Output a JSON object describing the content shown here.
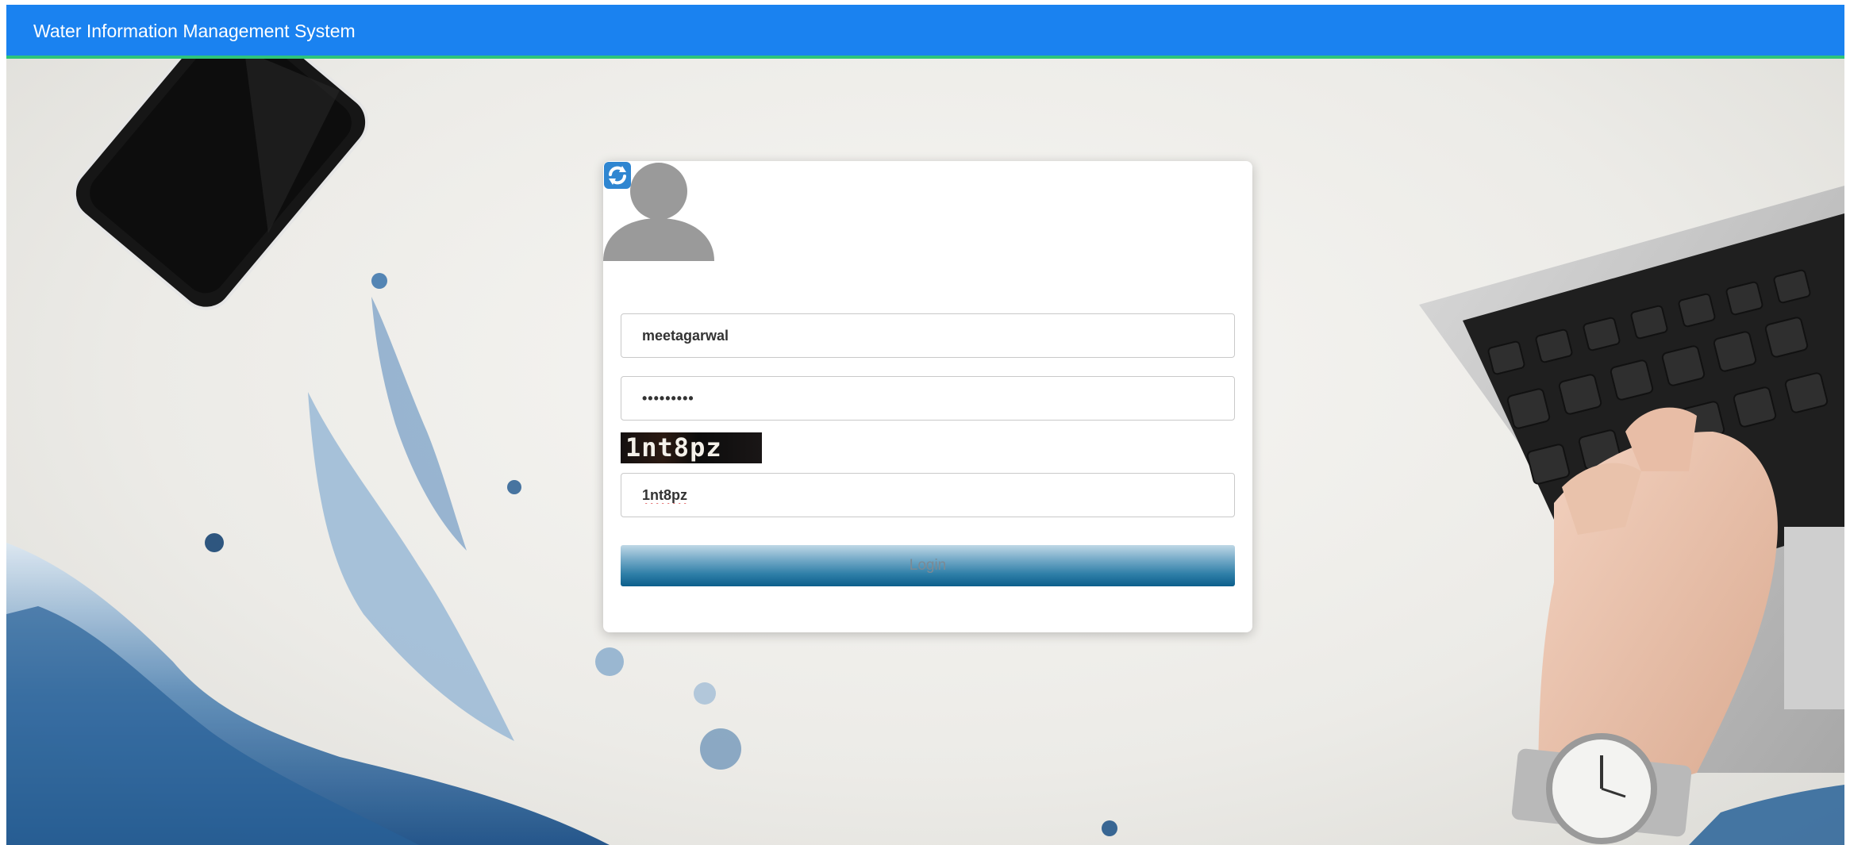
{
  "navbar": {
    "brand": "Water Information Management System",
    "color": "#1a82f0",
    "accent_border": "#2ec47a"
  },
  "login_form": {
    "avatar_icon": "user-avatar-icon",
    "username_value": "meetagarwal",
    "password_value": "•••••••••",
    "captcha_image_text": "1nt8pz",
    "refresh_icon": "refresh-captcha-icon",
    "captcha_input_value": "1nt8pz",
    "login_label": "Login"
  }
}
